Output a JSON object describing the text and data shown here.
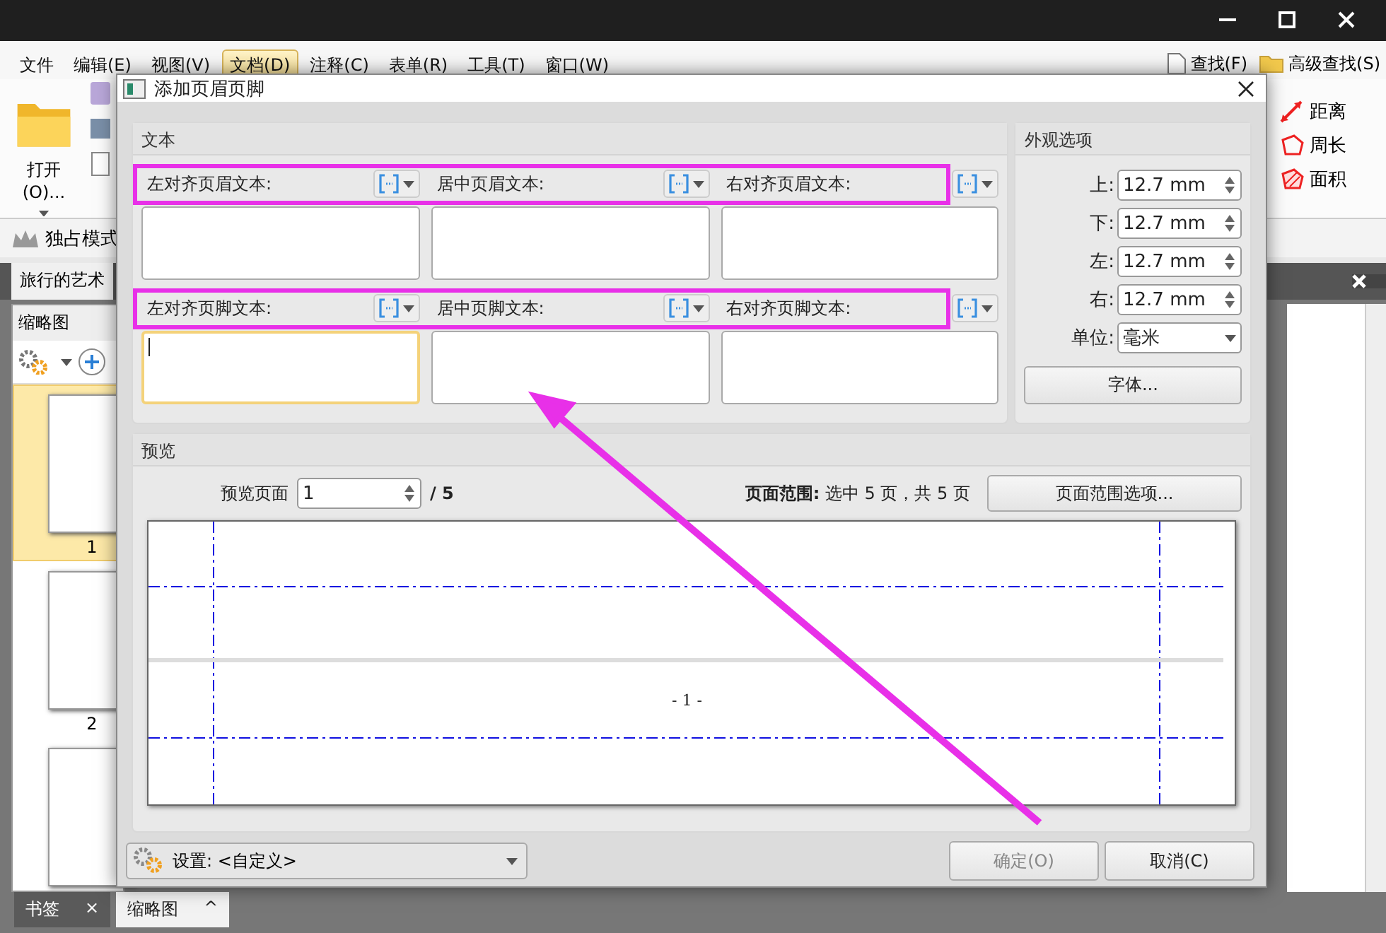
{
  "app": {
    "menu": [
      {
        "label": "文件",
        "selected": false
      },
      {
        "label": "编辑(E)",
        "selected": false
      },
      {
        "label": "视图(V)",
        "selected": false
      },
      {
        "label": "文档(D)",
        "selected": true
      },
      {
        "label": "注释(C)",
        "selected": false
      },
      {
        "label": "表单(R)",
        "selected": false
      },
      {
        "label": "工具(T)",
        "selected": false
      },
      {
        "label": "窗口(W)",
        "selected": false
      }
    ],
    "search_buttons": [
      "查找(F)",
      "高级查找(S)"
    ],
    "open_button": "打开(O)...",
    "measure_tools": [
      {
        "kind": "distance",
        "label": "距离"
      },
      {
        "kind": "perimeter",
        "label": "周长"
      },
      {
        "kind": "area",
        "label": "面积"
      }
    ],
    "exclusive_mode": "独占模式",
    "document_tab": "旅行的艺术",
    "thumbnail_panel": {
      "title": "缩略图",
      "pages": [
        {
          "label": "1",
          "selected": true
        },
        {
          "label": "2",
          "selected": false
        },
        {
          "selected": false
        }
      ]
    },
    "bottom_tabs": [
      {
        "label": "书签",
        "selected": false,
        "icon": "×"
      },
      {
        "label": "缩略图",
        "selected": true,
        "icon": "^"
      }
    ]
  },
  "dialog": {
    "title": "添加页眉页脚",
    "text_group": {
      "title": "文本",
      "rows": [
        {
          "highlighted": true,
          "fields": [
            {
              "label": "左对齐页眉文本:",
              "focused": false
            },
            {
              "label": "居中页眉文本:",
              "focused": false
            },
            {
              "label": "右对齐页眉文本:",
              "focused": false
            }
          ]
        },
        {
          "highlighted": true,
          "fields": [
            {
              "label": "左对齐页脚文本:",
              "focused": true
            },
            {
              "label": "居中页脚文本:",
              "focused": false
            },
            {
              "label": "右对齐页脚文本:",
              "focused": false
            }
          ]
        }
      ]
    },
    "appearance": {
      "title": "外观选项",
      "margins": [
        {
          "label": "上:",
          "value": "12.7 mm"
        },
        {
          "label": "下:",
          "value": "12.7 mm"
        },
        {
          "label": "左:",
          "value": "12.7 mm"
        },
        {
          "label": "右:",
          "value": "12.7 mm"
        }
      ],
      "unit": {
        "label": "单位:",
        "value": "毫米"
      },
      "font_button": "字体..."
    },
    "preview": {
      "title": "预览",
      "page_label": "预览页面",
      "page_value": "1",
      "page_total": "/ 5",
      "range_text": "**页面范围:** 选中 5 页，共 5 页",
      "range_button": "页面范围选项...",
      "page_number": "- 1 -"
    },
    "footer": {
      "settings": "设置: <自定义>",
      "buttons": [
        {
          "label": "确定(O)",
          "disabled": true
        },
        {
          "label": "取消(C)",
          "disabled": false
        }
      ]
    }
  },
  "annotations": [
    {
      "kind": "arrow"
    }
  ]
}
